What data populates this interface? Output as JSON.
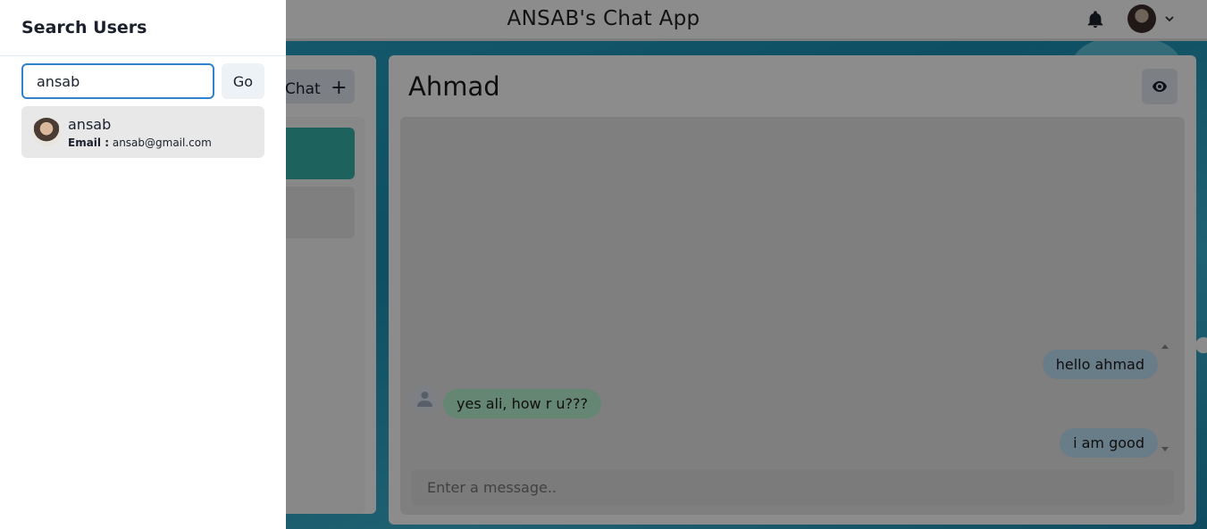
{
  "app": {
    "title": "ANSAB's Chat App"
  },
  "header": {
    "bell_icon": "bell-icon",
    "avatar_icon": "avatar",
    "chevron_icon": "chevron-down-icon"
  },
  "sidebar": {
    "new_chat_label": "Chat"
  },
  "chat": {
    "name": "Ahmad",
    "messages": [
      {
        "text": "hello ahmad",
        "type": "sent"
      },
      {
        "text": "yes ali, how r u???",
        "type": "received"
      },
      {
        "text": "i am good",
        "type": "sent"
      }
    ],
    "input_placeholder": "Enter a message.."
  },
  "drawer": {
    "title": "Search Users",
    "search_value": "ansab",
    "go_label": "Go",
    "results": [
      {
        "name": "ansab",
        "email_label": "Email :",
        "email": "ansab@gmail.com"
      }
    ]
  },
  "colors": {
    "accent": "#38b2ac",
    "sent_bubble": "#bee3f8",
    "received_bubble": "#b9f5d0",
    "focus_border": "#3182ce"
  }
}
